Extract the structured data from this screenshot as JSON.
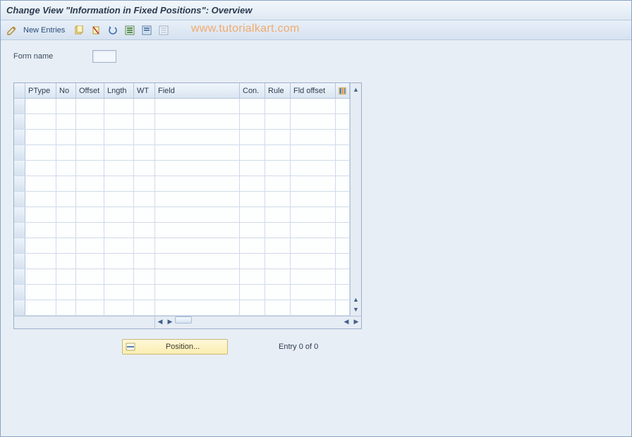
{
  "title": "Change View \"Information in Fixed Positions\": Overview",
  "toolbar": {
    "new_entries_label": "New Entries"
  },
  "watermark": "www.tutorialkart.com",
  "form": {
    "name_label": "Form name",
    "name_value": ""
  },
  "table": {
    "headers": {
      "ptype": "PType",
      "no": "No",
      "offset": "Offset",
      "lngth": "Lngth",
      "wt": "WT",
      "field": "Field",
      "con": "Con.",
      "rule": "Rule",
      "fldoffset": "Fld offset"
    },
    "rows": []
  },
  "footer": {
    "position_label": "Position...",
    "entry_text": "Entry 0 of 0"
  }
}
